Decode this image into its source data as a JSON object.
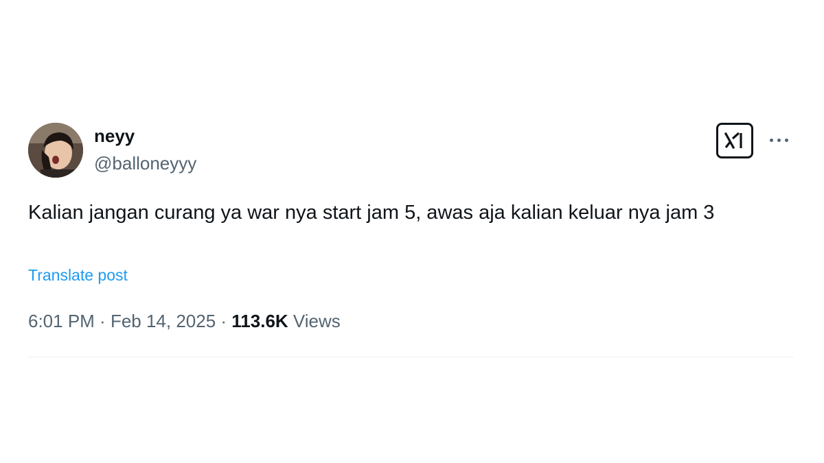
{
  "author": {
    "display_name": "neyy",
    "handle": "@balloneyyy",
    "avatar_icon": "profile-photo"
  },
  "actions": {
    "grok_icon": "grok-icon",
    "more_icon": "more-horizontal-icon"
  },
  "post": {
    "text": "Kalian jangan curang ya war nya start jam 5, awas aja kalian keluar nya jam 3",
    "translate_label": "Translate post"
  },
  "meta": {
    "time": "6:01 PM",
    "separator1": " · ",
    "date": "Feb 14, 2025",
    "separator2": " · ",
    "views_count": "113.6K",
    "views_label": " Views"
  },
  "colors": {
    "text_primary": "#0f1419",
    "text_secondary": "#536471",
    "link": "#1d9bf0"
  }
}
